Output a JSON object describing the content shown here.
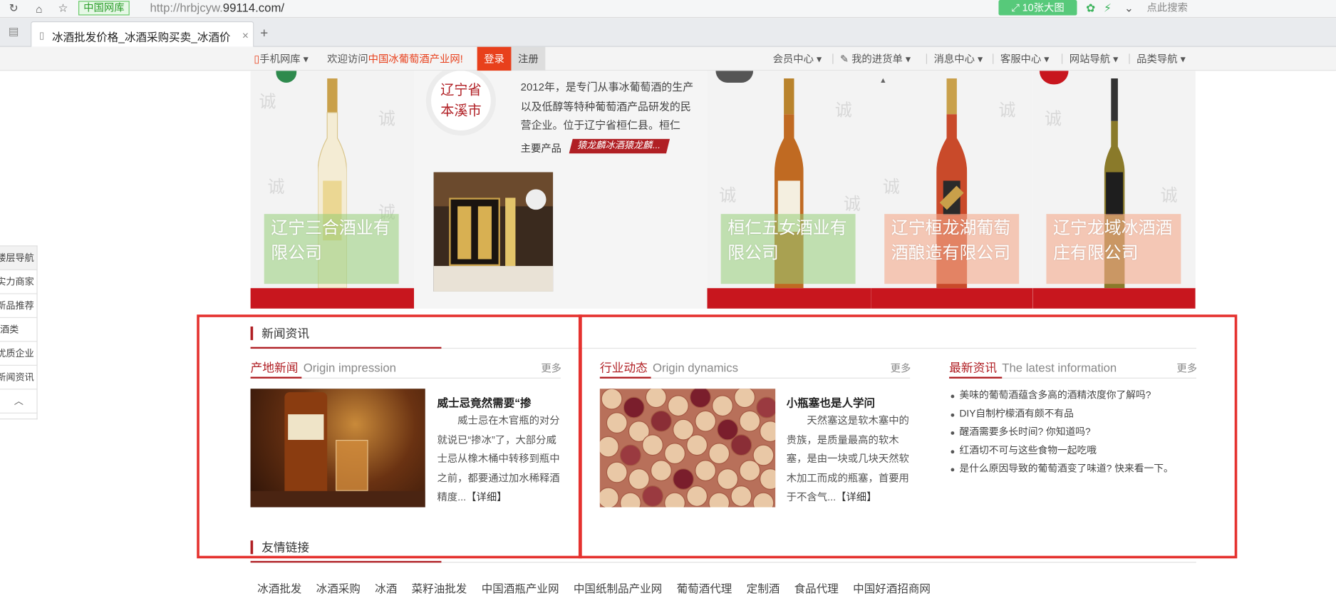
{
  "browser": {
    "site_badge": "中国网库",
    "url_prefix": "http://hrbjcyw.",
    "url_domain": "99114.com/",
    "big_image_btn": "10张大图",
    "search_hint": "点此搜索",
    "tab_title": "冰酒批发价格_冰酒采购买卖_冰酒价",
    "new_tab": "+",
    "tab_close": "×"
  },
  "topbar": {
    "mobile": "手机网库",
    "welcome": "欢迎访问",
    "site_name": "中国冰葡萄酒产业网!",
    "login": "登录",
    "register": "注册",
    "menus": [
      "会员中心",
      "我的进货单",
      "消息中心",
      "客服中心",
      "网站导航",
      "品类导航"
    ]
  },
  "leftnav": {
    "items": [
      "楼层导航",
      "实力商家",
      "新品推荐",
      "酒类",
      "优质企业",
      "新闻资讯"
    ],
    "up": "︿"
  },
  "panels": {
    "p1_name": "辽宁三合酒业有限公司",
    "province": "辽宁省",
    "city": "本溪市",
    "intro": "2012年，是专门从事冰葡萄酒的生产以及低醇等特种葡萄酒产品研发的民营企业。位于辽宁省桓仁县。桓仁素...",
    "main_products_label": "主要产品",
    "main_products": "猿龙麟冰酒猿龙麟...",
    "p3_name": "桓仁五女酒业有限公司",
    "p4_name": "辽宁桓龙湖葡萄酒酿造有限公司",
    "p5_name": "辽宁龙域冰酒酒庄有限公司"
  },
  "news": {
    "section_title": "新闻资讯",
    "origin": {
      "cn": "产地新闻",
      "en": "Origin impression",
      "more": "更多",
      "title": "威士忌竟然需要“掺",
      "body": "威士忌在木官瓶的对分就说已“掺冰”了，大部分威士忌从橡木桶中转移到瓶中之前，都要通过加水稀释酒精度...",
      "detail": "【详细】"
    },
    "industry": {
      "cn": "行业动态",
      "en": "Origin dynamics",
      "more": "更多",
      "title": "小瓶塞也是人学问",
      "body": "天然塞这是软木塞中的贵族，是质量最高的软木塞，是由一块或几块天然软木加工而成的瓶塞，首要用于不含气...",
      "detail": "【详细】"
    },
    "latest": {
      "cn": "最新资讯",
      "en": "The latest information",
      "more": "更多",
      "items": [
        "美味的葡萄酒蕴含多高的酒精浓度你了解吗?",
        "DIY自制柠檬酒有颇不有品",
        "醒酒需要多长时间? 你知道吗?",
        "红酒切不可与这些食物一起吃哦",
        "是什么原因导致的葡萄酒变了味道? 快来看一下。"
      ]
    }
  },
  "friends": {
    "title": "友情链接",
    "links": [
      "冰酒批发",
      "冰酒采购",
      "冰酒",
      "菜籽油批发",
      "中国酒瓶产业网",
      "中国纸制品产业网",
      "葡萄酒代理",
      "定制酒",
      "食品代理",
      "中国好酒招商网"
    ]
  },
  "colors": {
    "brand_red": "#b01f24",
    "annotation_red": "#e5322f",
    "login_orange": "#e8401c"
  }
}
